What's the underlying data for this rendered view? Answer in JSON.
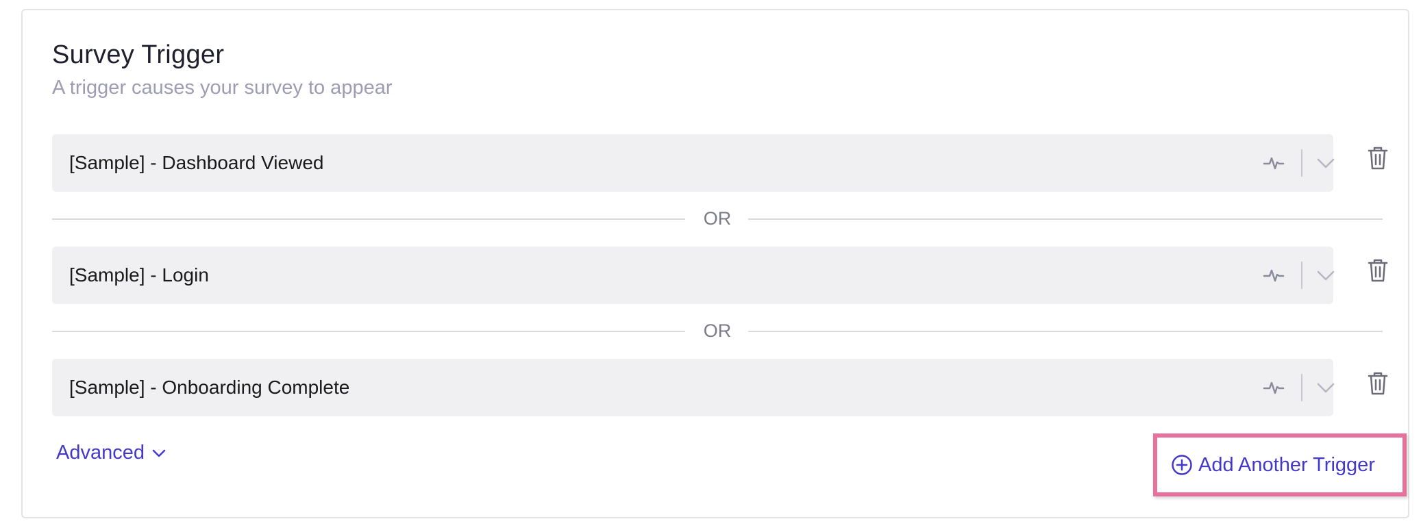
{
  "panel": {
    "title": "Survey Trigger",
    "subtitle": "A trigger causes your survey to appear"
  },
  "triggers": [
    {
      "label": "[Sample] - Dashboard Viewed"
    },
    {
      "label": "[Sample] - Login"
    },
    {
      "label": "[Sample] - Onboarding Complete"
    }
  ],
  "separator_label": "OR",
  "advanced_label": "Advanced",
  "add_trigger_label": "Add Another Trigger",
  "colors": {
    "accent": "#4338ca",
    "highlight": "#e8719b",
    "field_bg": "#f0f0f2",
    "muted": "#9d9cb3"
  },
  "icons": [
    "activity-icon",
    "chevron-down-icon",
    "trash-icon",
    "plus-circle-icon"
  ]
}
